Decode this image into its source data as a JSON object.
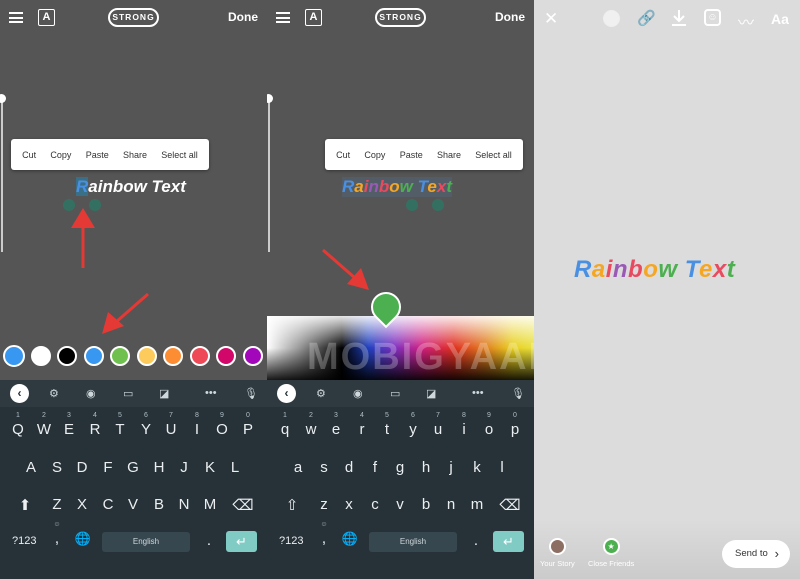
{
  "toolbar": {
    "style_label": "STRONG",
    "done_label": "Done",
    "font_icon": "text-style-icon",
    "menu_icon": "align-menu-icon"
  },
  "context_menu": [
    "Cut",
    "Copy",
    "Paste",
    "Share",
    "Select all"
  ],
  "text_panel1": {
    "first": "R",
    "rest": "ainbow Text"
  },
  "rainbow_text": {
    "letters": [
      {
        "ch": "R",
        "color": "#4a90e2"
      },
      {
        "ch": "a",
        "color": "#f5a623"
      },
      {
        "ch": "i",
        "color": "#e84a5f"
      },
      {
        "ch": "n",
        "color": "#9b59b6"
      },
      {
        "ch": "b",
        "color": "#e84a5f"
      },
      {
        "ch": "o",
        "color": "#f5a623"
      },
      {
        "ch": "w",
        "color": "#4caf50"
      },
      {
        "ch": " ",
        "color": "#ffffff"
      },
      {
        "ch": "T",
        "color": "#4a90e2"
      },
      {
        "ch": "e",
        "color": "#f5a623"
      },
      {
        "ch": "x",
        "color": "#e84a5f"
      },
      {
        "ch": "t",
        "color": "#4caf50"
      }
    ]
  },
  "swatch_colors": [
    "#ffffff",
    "#000000",
    "#3897f0",
    "#70c050",
    "#fdcb5c",
    "#fd8d32",
    "#ed4956",
    "#d10869",
    "#a307ba"
  ],
  "keyboard": {
    "row1_upper": [
      "Q",
      "W",
      "E",
      "R",
      "T",
      "Y",
      "U",
      "I",
      "O",
      "P"
    ],
    "row1_lower": [
      "q",
      "w",
      "e",
      "r",
      "t",
      "y",
      "u",
      "i",
      "o",
      "p"
    ],
    "row1_nums": [
      "1",
      "2",
      "3",
      "4",
      "5",
      "6",
      "7",
      "8",
      "9",
      "0"
    ],
    "row2_upper": [
      "A",
      "S",
      "D",
      "F",
      "G",
      "H",
      "J",
      "K",
      "L"
    ],
    "row2_lower": [
      "a",
      "s",
      "d",
      "f",
      "g",
      "h",
      "j",
      "k",
      "l"
    ],
    "row3_upper": [
      "Z",
      "X",
      "C",
      "V",
      "B",
      "N",
      "M"
    ],
    "row3_lower": [
      "z",
      "x",
      "c",
      "v",
      "b",
      "n",
      "m"
    ],
    "sym_label": "?123",
    "comma": ",",
    "period": ".",
    "space_label": "English"
  },
  "watermark": "MOBIGYAAN",
  "story": {
    "your_story": "Your Story",
    "close_friends": "Close Friends",
    "send_label": "Send to"
  },
  "top_icons": [
    "close-icon",
    "color-icon",
    "link-icon",
    "download-icon",
    "sticker-icon",
    "draw-icon",
    "text-icon"
  ],
  "aa_label": "Aa"
}
